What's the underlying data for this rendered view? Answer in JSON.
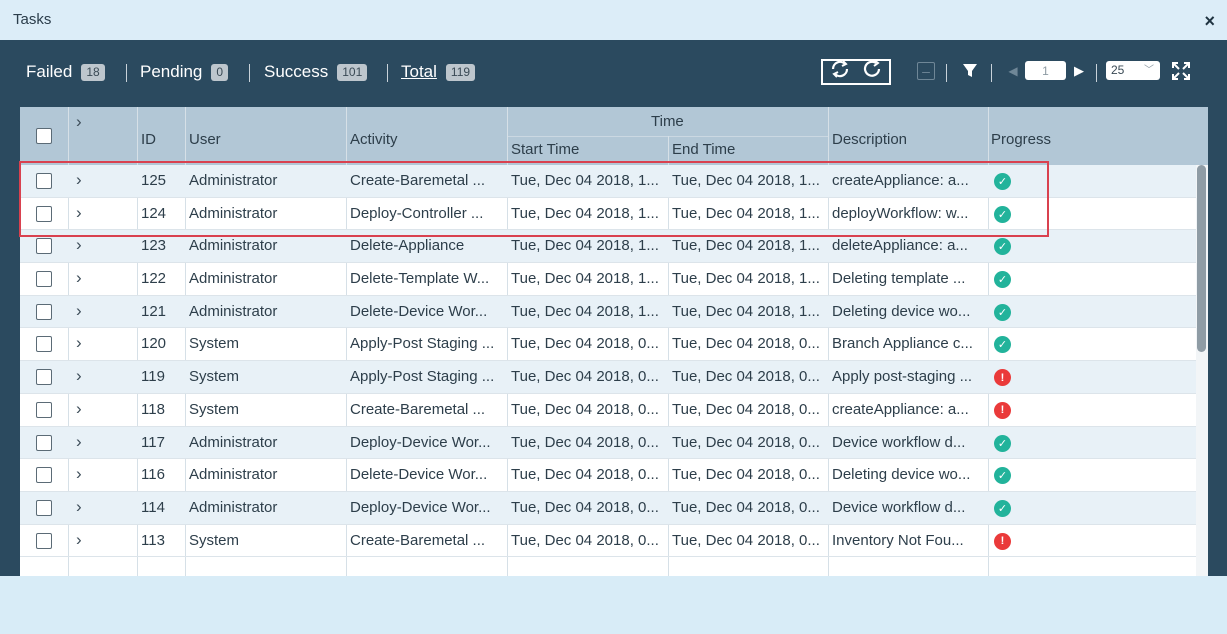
{
  "window": {
    "title": "Tasks",
    "close_glyph": "×"
  },
  "stats": {
    "failed": {
      "label": "Failed",
      "count": "18"
    },
    "pending": {
      "label": "Pending",
      "count": "0"
    },
    "success": {
      "label": "Success",
      "count": "101"
    },
    "total": {
      "label": "Total",
      "count": "119"
    }
  },
  "toolbar": {
    "page_value": "1",
    "page_size": "25",
    "icons": [
      "auto-refresh-icon",
      "refresh-icon",
      "collapse-icon",
      "filter-icon",
      "prev-page-icon",
      "next-page-icon",
      "fullscreen-icon"
    ]
  },
  "columns": {
    "id": "ID",
    "user": "User",
    "activity": "Activity",
    "time": "Time",
    "start_time": "Start Time",
    "end_time": "End Time",
    "description": "Description",
    "progress": "Progress"
  },
  "rows": [
    {
      "id": "125",
      "user": "Administrator",
      "activity": "Create-Baremetal ...",
      "start": "Tue, Dec 04 2018, 1...",
      "end": "Tue, Dec 04 2018, 1...",
      "desc": "createAppliance: a...",
      "status": "success"
    },
    {
      "id": "124",
      "user": "Administrator",
      "activity": "Deploy-Controller ...",
      "start": "Tue, Dec 04 2018, 1...",
      "end": "Tue, Dec 04 2018, 1...",
      "desc": "deployWorkflow: w...",
      "status": "success"
    },
    {
      "id": "123",
      "user": "Administrator",
      "activity": "Delete-Appliance",
      "start": "Tue, Dec 04 2018, 1...",
      "end": "Tue, Dec 04 2018, 1...",
      "desc": "deleteAppliance: a...",
      "status": "success"
    },
    {
      "id": "122",
      "user": "Administrator",
      "activity": "Delete-Template W...",
      "start": "Tue, Dec 04 2018, 1...",
      "end": "Tue, Dec 04 2018, 1...",
      "desc": "Deleting template ...",
      "status": "success"
    },
    {
      "id": "121",
      "user": "Administrator",
      "activity": "Delete-Device Wor...",
      "start": "Tue, Dec 04 2018, 1...",
      "end": "Tue, Dec 04 2018, 1...",
      "desc": "Deleting device wo...",
      "status": "success"
    },
    {
      "id": "120",
      "user": "System",
      "activity": "Apply-Post Staging ...",
      "start": "Tue, Dec 04 2018, 0...",
      "end": "Tue, Dec 04 2018, 0...",
      "desc": "Branch Appliance c...",
      "status": "success"
    },
    {
      "id": "119",
      "user": "System",
      "activity": "Apply-Post Staging ...",
      "start": "Tue, Dec 04 2018, 0...",
      "end": "Tue, Dec 04 2018, 0...",
      "desc": "Apply post-staging ...",
      "status": "failed"
    },
    {
      "id": "118",
      "user": "System",
      "activity": "Create-Baremetal ...",
      "start": "Tue, Dec 04 2018, 0...",
      "end": "Tue, Dec 04 2018, 0...",
      "desc": "createAppliance: a...",
      "status": "failed"
    },
    {
      "id": "117",
      "user": "Administrator",
      "activity": "Deploy-Device Wor...",
      "start": "Tue, Dec 04 2018, 0...",
      "end": "Tue, Dec 04 2018, 0...",
      "desc": "Device workflow d...",
      "status": "success"
    },
    {
      "id": "116",
      "user": "Administrator",
      "activity": "Delete-Device Wor...",
      "start": "Tue, Dec 04 2018, 0...",
      "end": "Tue, Dec 04 2018, 0...",
      "desc": "Deleting device wo...",
      "status": "success"
    },
    {
      "id": "114",
      "user": "Administrator",
      "activity": "Deploy-Device Wor...",
      "start": "Tue, Dec 04 2018, 0...",
      "end": "Tue, Dec 04 2018, 0...",
      "desc": "Device workflow d...",
      "status": "success"
    },
    {
      "id": "113",
      "user": "System",
      "activity": "Create-Baremetal ...",
      "start": "Tue, Dec 04 2018, 0...",
      "end": "Tue, Dec 04 2018, 0...",
      "desc": "Inventory Not Fou...",
      "status": "failed"
    }
  ],
  "colors": {
    "success": "#22b39b",
    "failed": "#ea3a3a",
    "panel": "#2b4a5f",
    "header": "#b2c7d6",
    "highlight": "#d9414f"
  }
}
